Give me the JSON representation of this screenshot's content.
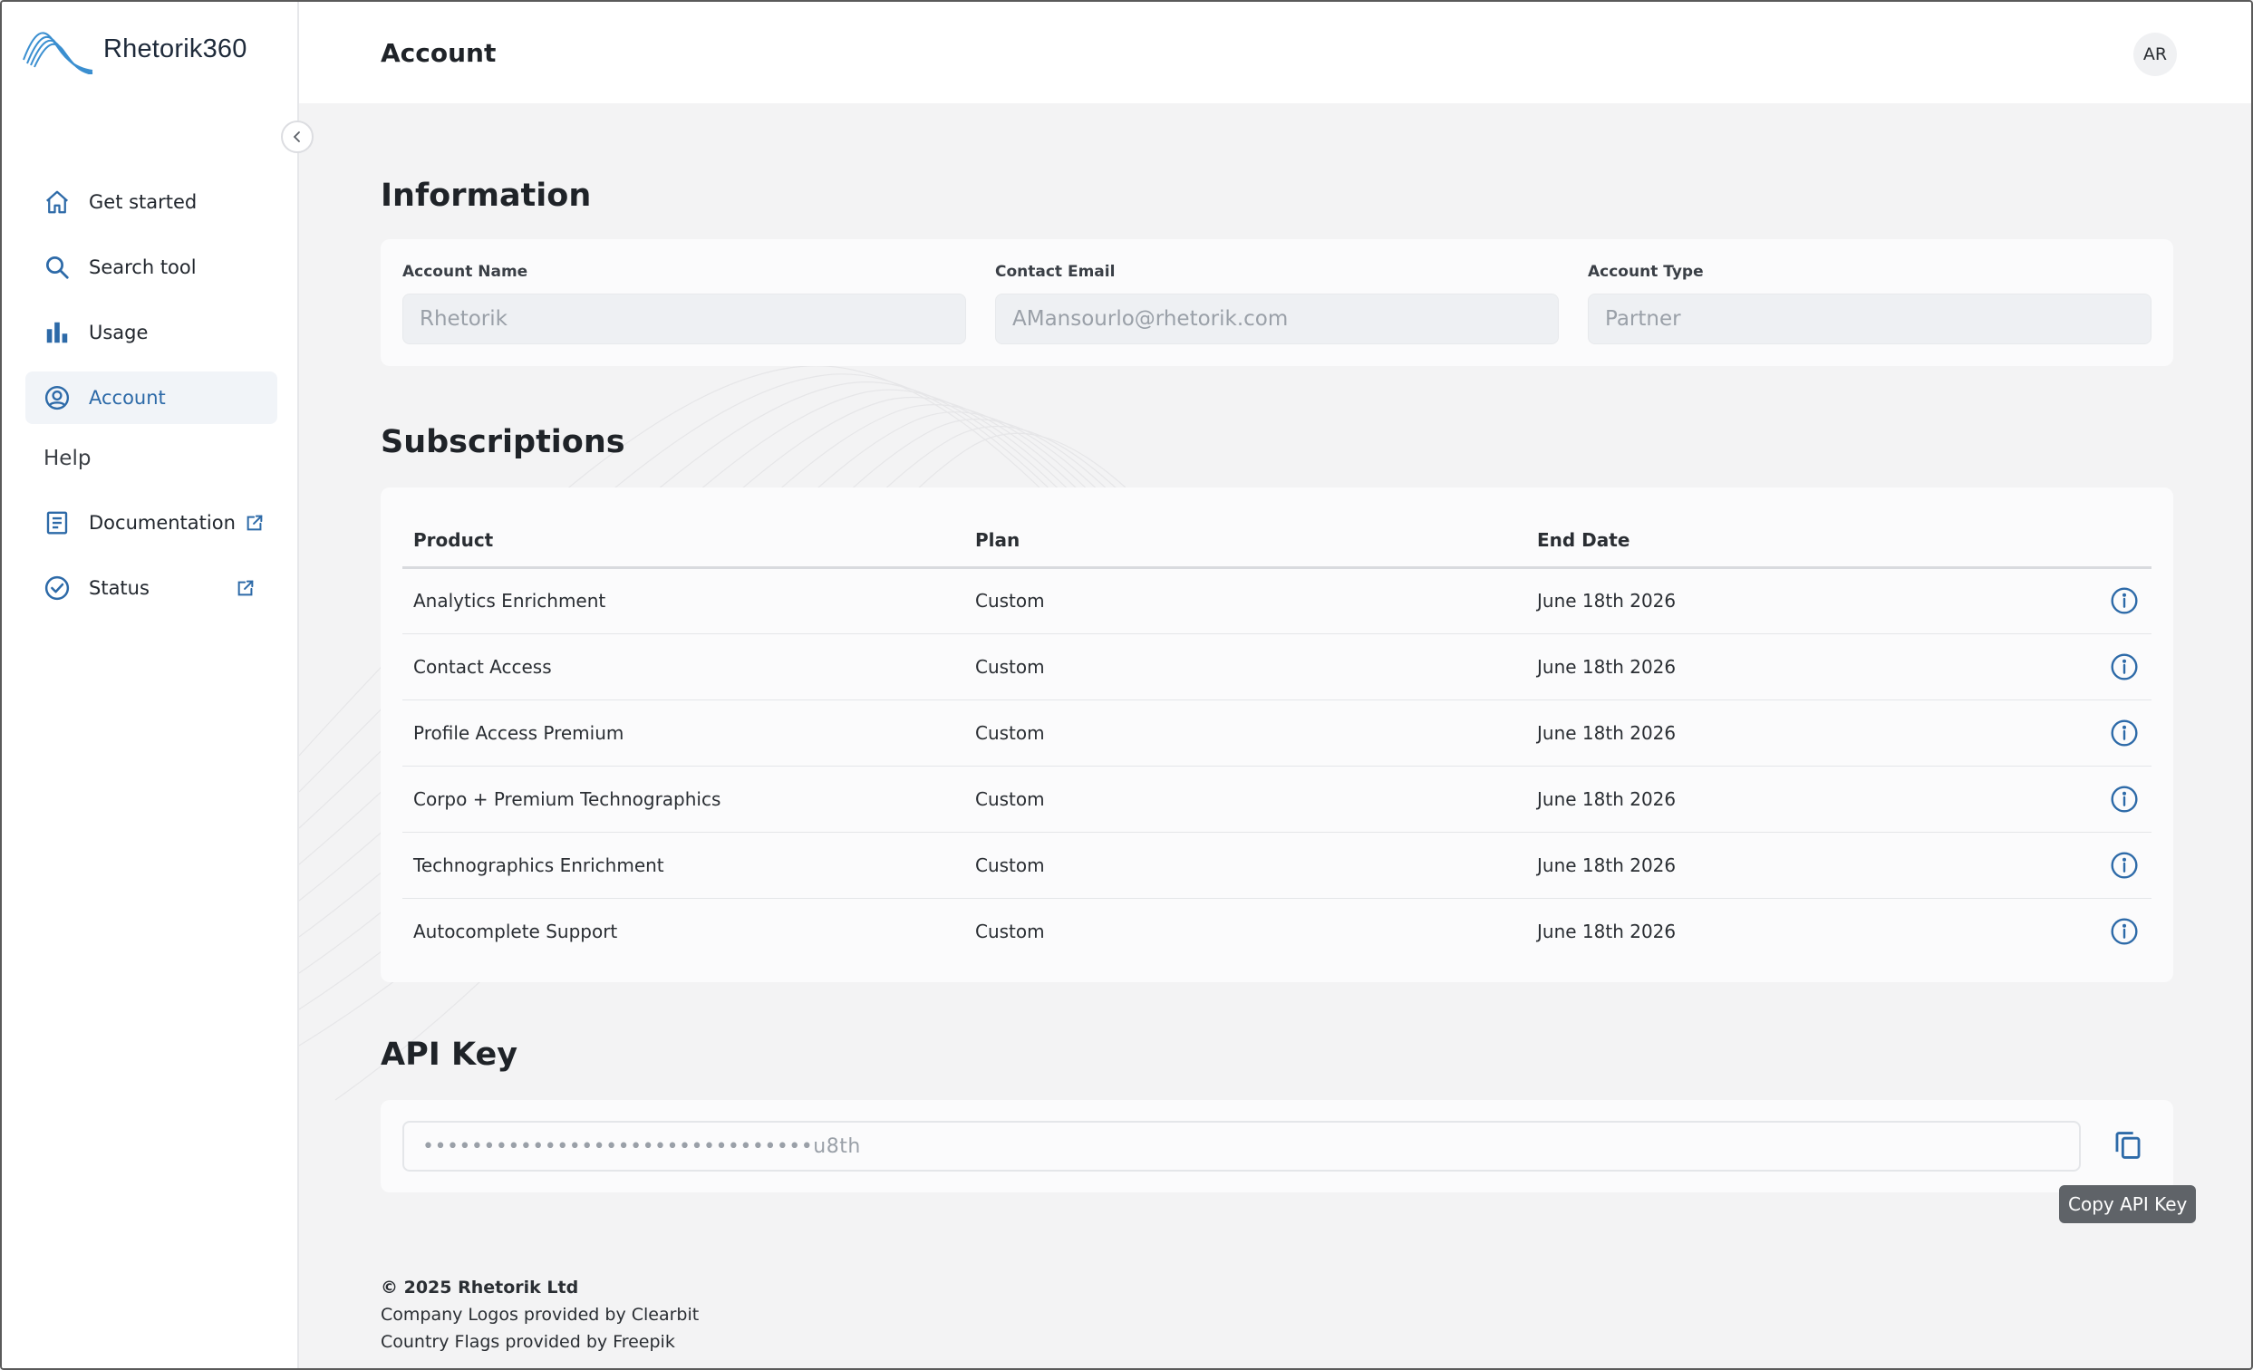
{
  "app": {
    "name": "Rhetorik360",
    "accent": "#2d6aa8"
  },
  "sidebar": {
    "items": [
      {
        "label": "Get started",
        "icon": "home-icon"
      },
      {
        "label": "Search tool",
        "icon": "search-icon"
      },
      {
        "label": "Usage",
        "icon": "bar-chart-icon"
      },
      {
        "label": "Account",
        "icon": "account-circle-icon",
        "active": true
      }
    ],
    "help_label": "Help",
    "help_items": [
      {
        "label": "Documentation",
        "icon": "document-icon",
        "external": true
      },
      {
        "label": "Status",
        "icon": "check-circle-icon",
        "external": true
      }
    ]
  },
  "header": {
    "title": "Account",
    "avatar_initials": "AR"
  },
  "information": {
    "title": "Information",
    "fields": [
      {
        "label": "Account Name",
        "value": "Rhetorik"
      },
      {
        "label": "Contact Email",
        "value": "AMansourlo@rhetorik.com"
      },
      {
        "label": "Account Type",
        "value": "Partner"
      }
    ]
  },
  "subscriptions": {
    "title": "Subscriptions",
    "columns": [
      "Product",
      "Plan",
      "End Date"
    ],
    "rows": [
      {
        "product": "Analytics Enrichment",
        "plan": "Custom",
        "end_date": "June 18th 2026"
      },
      {
        "product": "Contact Access",
        "plan": "Custom",
        "end_date": "June 18th 2026"
      },
      {
        "product": "Profile Access Premium",
        "plan": "Custom",
        "end_date": "June 18th 2026"
      },
      {
        "product": "Corpo + Premium Technographics",
        "plan": "Custom",
        "end_date": "June 18th 2026"
      },
      {
        "product": "Technographics Enrichment",
        "plan": "Custom",
        "end_date": "June 18th 2026"
      },
      {
        "product": "Autocomplete Support",
        "plan": "Custom",
        "end_date": "June 18th 2026"
      }
    ]
  },
  "api_key": {
    "title": "API Key",
    "masked_value": "••••••••••••••••••••••••••••••••u8th",
    "copy_tooltip": "Copy API Key"
  },
  "footer": {
    "copyright": "© 2025 Rhetorik Ltd",
    "line1": "Company Logos provided by Clearbit",
    "line2": "Country Flags provided by Freepik"
  }
}
